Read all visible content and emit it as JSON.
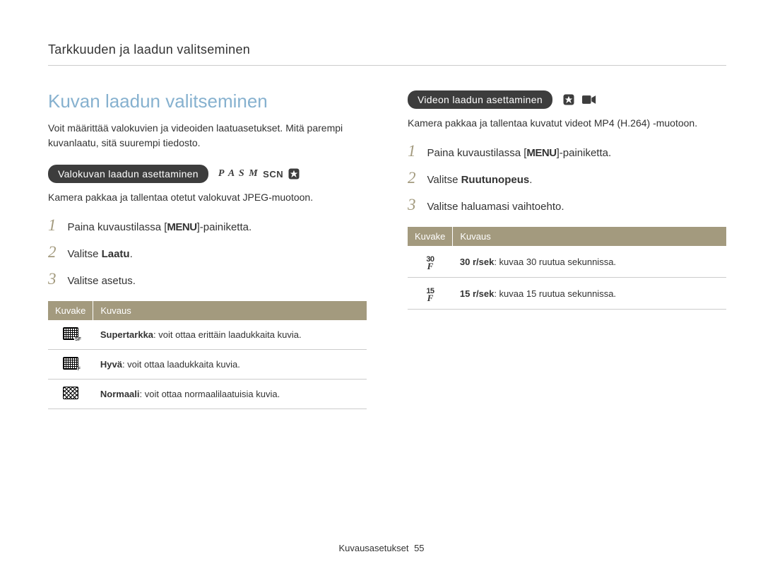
{
  "breadcrumb": "Tarkkuuden ja laadun valitseminen",
  "main_title": "Kuvan laadun valitseminen",
  "intro": "Voit määrittää valokuvien ja videoiden laatuasetukset. Mitä parempi kuvanlaatu, sitä suurempi tiedosto.",
  "photo": {
    "pill": "Valokuvan laadun asettaminen",
    "modes": "P A S M",
    "modes_scn": "SCN",
    "desc": "Kamera pakkaa ja tallentaa otetut valokuvat JPEG-muotoon.",
    "steps": [
      {
        "pre": "Paina kuvaustilassa [",
        "key": "MENU",
        "post": "]-painiketta."
      },
      {
        "pre": "Valitse ",
        "bold": "Laatu",
        "post": "."
      },
      {
        "pre": "Valitse asetus.",
        "bold": "",
        "post": ""
      }
    ],
    "th1": "Kuvake",
    "th2": "Kuvaus",
    "rows": [
      {
        "icon": "sf",
        "bold": "Supertarkka",
        "text": ": voit ottaa erittäin laadukkaita kuvia."
      },
      {
        "icon": "f",
        "bold": "Hyvä",
        "text": ": voit ottaa laadukkaita kuvia."
      },
      {
        "icon": "n",
        "bold": "Normaali",
        "text": ": voit ottaa normaalilaatuisia kuvia."
      }
    ]
  },
  "video": {
    "pill": "Videon laadun asettaminen",
    "desc": "Kamera pakkaa ja tallentaa kuvatut videot MP4 (H.264) -muotoon.",
    "steps": [
      {
        "pre": "Paina kuvaustilassa [",
        "key": "MENU",
        "post": "]-painiketta."
      },
      {
        "pre": "Valitse ",
        "bold": "Ruutunopeus",
        "post": "."
      },
      {
        "pre": "Valitse haluamasi vaihtoehto.",
        "bold": "",
        "post": ""
      }
    ],
    "th1": "Kuvake",
    "th2": "Kuvaus",
    "rows": [
      {
        "fps": "30",
        "bold": "30 r/sek",
        "text": ": kuvaa 30 ruutua sekunnissa."
      },
      {
        "fps": "15",
        "bold": "15 r/sek",
        "text": ": kuvaa 15 ruutua sekunnissa."
      }
    ]
  },
  "footer": {
    "section": "Kuvausasetukset",
    "page": "55"
  }
}
